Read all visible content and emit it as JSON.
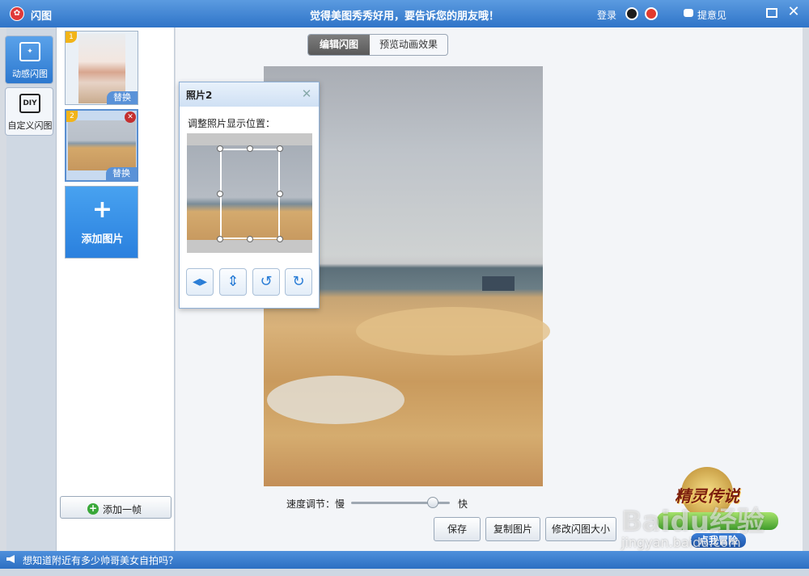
{
  "titlebar": {
    "app_name": "闪图",
    "slogan": "觉得美图秀秀好用，要告诉您的朋友哦！",
    "login": "登录",
    "feedback": "提意见",
    "icons": [
      "qq-icon",
      "weibo-icon",
      "maximize-icon",
      "close-icon"
    ]
  },
  "sidebar": {
    "tabs": [
      {
        "label": "动感闪图",
        "icon": "sparkle-icon"
      },
      {
        "label": "自定义闪图",
        "icon": "DIY"
      }
    ]
  },
  "frames": {
    "items": [
      {
        "number": "1",
        "action": "替换"
      },
      {
        "number": "2",
        "action": "替换"
      }
    ],
    "add_image": "添加图片",
    "add_frame": "添加一帧"
  },
  "editor": {
    "tab_edit": "编辑闪图",
    "tab_preview": "预览动画效果"
  },
  "popup": {
    "title": "照片2",
    "instruction": "调整照片显示位置：",
    "tools": [
      "flip-horizontal-icon",
      "flip-vertical-icon",
      "rotate-left-icon",
      "rotate-right-icon"
    ]
  },
  "controls": {
    "speed_label": "速度调节：慢",
    "speed_fast": "快",
    "speed_value": 0.83,
    "save": "保存",
    "copy_image": "复制图片",
    "resize": "修改闪图大小"
  },
  "promo": {
    "title": "精灵传说",
    "button": "点我冒险"
  },
  "statusbar": {
    "text": "想知道附近有多少帅哥美女自拍吗？"
  },
  "watermark": {
    "text": "Baidu经验",
    "sub": "jingyan.baidu.com"
  },
  "colors": {
    "accent": "#2f74c8",
    "title_bar": "#5b9be0",
    "add_button": "#2a80de"
  }
}
